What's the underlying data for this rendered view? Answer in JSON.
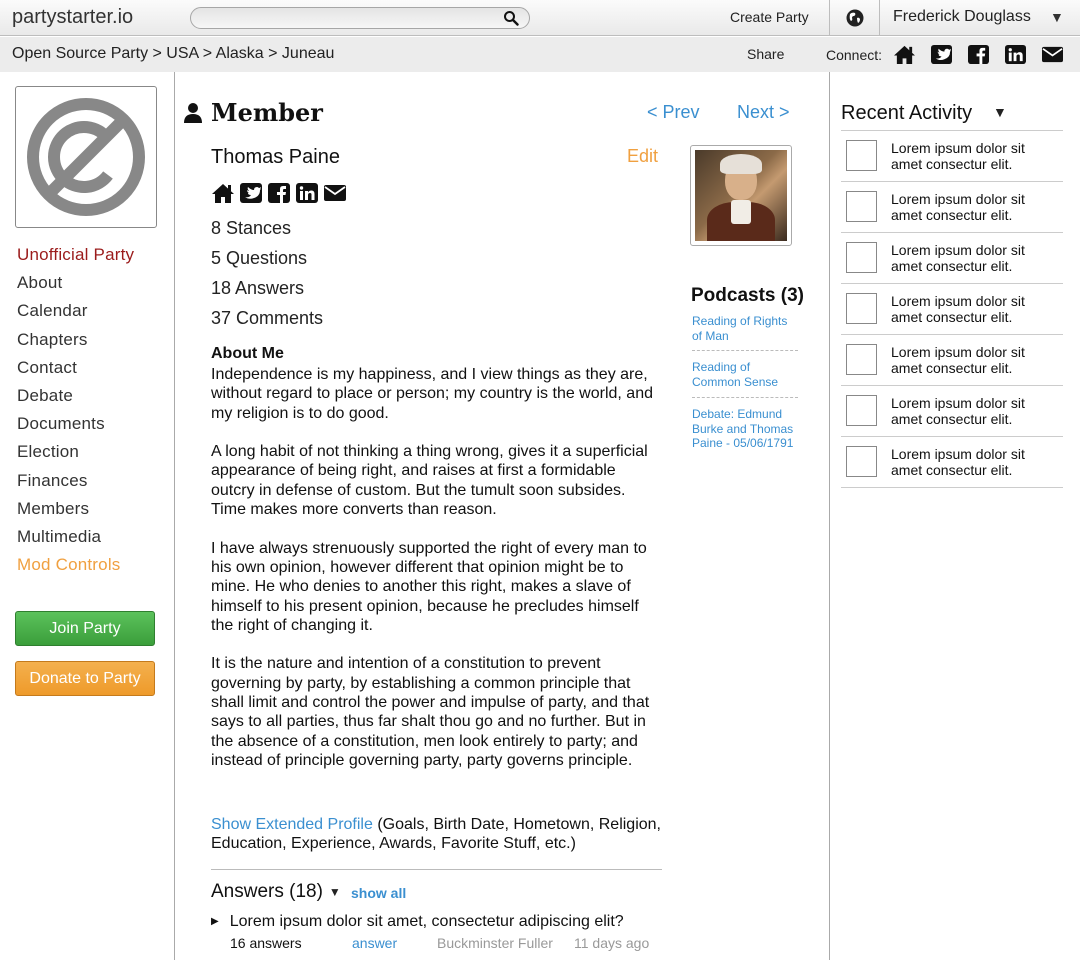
{
  "header": {
    "logo": "partystarter.io",
    "create_party": "Create Party",
    "user_name": "Frederick Douglass"
  },
  "breadcrumb": "Open Source Party > USA > Alaska > Juneau",
  "share_label": "Share",
  "connect_label": "Connect:",
  "sidebar": {
    "items": [
      "Unofficial Party",
      "About",
      "Calendar",
      "Chapters",
      "Contact",
      "Debate",
      "Documents",
      "Election",
      "Finances",
      "Members",
      "Multimedia",
      "Mod Controls"
    ],
    "join_button": "Join Party",
    "donate_button": "Donate to Party"
  },
  "main": {
    "page_title": "Member",
    "prev": "< Prev",
    "next": "Next >",
    "member_name": "Thomas Paine",
    "edit": "Edit",
    "stats": [
      "8 Stances",
      "5 Questions",
      "18 Answers",
      "37 Comments"
    ],
    "about_heading": "About Me",
    "about_paragraphs": [
      "Independence is my happiness, and I view things as they are, without regard to place or person; my country is the world, and my religion is to do good.",
      "A long habit of not thinking a thing wrong, gives it a superficial appearance of being right, and raises at first a formidable outcry in defense of custom. But the tumult soon subsides. Time makes more converts than reason.",
      "I have always strenuously supported the right of every man to his own opinion, however different that opinion might be to mine. He who denies to another this right, makes a slave of himself to his present opinion, because he precludes himself the right of changing it.",
      "It is the nature and intention of a constitution to prevent governing by party, by establishing a common principle that shall limit and control the power and impulse of party, and that says to all parties, thus far shalt thou go and no further. But in the absence of a constitution, men look entirely to party; and instead of principle governing party, party governs principle."
    ],
    "extended_link": "Show Extended Profile",
    "extended_text": " (Goals, Birth Date, Hometown, Religion, Education, Experience,  Awards, Favorite Stuff, etc.)",
    "answers_title": "Answers (18)",
    "show_all": "show all",
    "answer": {
      "question": "Lorem ipsum dolor sit amet, consectetur adipiscing elit?",
      "count": "16 answers",
      "action": "answer",
      "author": "Buckminster Fuller",
      "time": "11 days ago"
    }
  },
  "podcasts": {
    "title": "Podcasts (3)",
    "items": [
      "Reading of Rights of Man",
      "Reading of Common Sense",
      "Debate: Edmund Burke and Thomas Paine - 05/06/1791"
    ]
  },
  "recent": {
    "title": "Recent Activity",
    "items": [
      "Lorem ipsum dolor sit amet consectur elit.",
      "Lorem ipsum dolor sit amet consectur elit.",
      "Lorem ipsum dolor sit amet consectur elit.",
      "Lorem ipsum dolor sit amet consectur elit.",
      "Lorem ipsum dolor sit amet consectur elit.",
      "Lorem ipsum dolor sit amet consectur elit.",
      "Lorem ipsum dolor sit amet consectur elit."
    ]
  },
  "colors": {
    "link": "#3a8fd0",
    "party_name": "#9b1c1c",
    "mod_controls": "#f0a040",
    "join_button": "#4cae4c",
    "donate_button": "#f0a63a"
  }
}
